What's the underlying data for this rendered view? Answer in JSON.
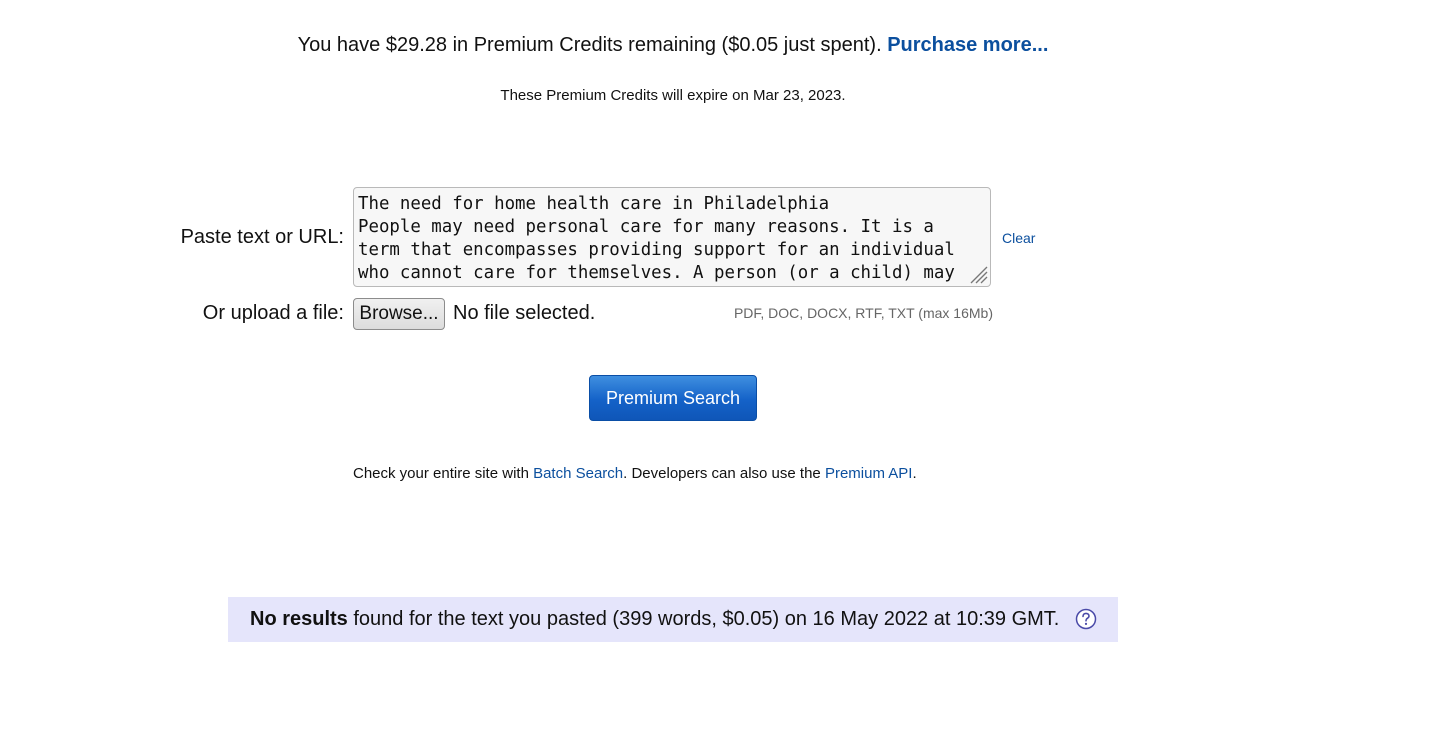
{
  "credits": {
    "text": "You have $29.28 in Premium Credits remaining ($0.05 just spent). ",
    "purchase_link": "Purchase more...",
    "expire_text": "These Premium Credits will expire on Mar 23, 2023."
  },
  "form": {
    "paste_label": "Paste text or URL:",
    "text_value": "The need for home health care in Philadelphia\nPeople may need personal care for many reasons. It is a term that encompasses providing support for an individual who cannot care for themselves. A person (or a child) may",
    "clear_link": "Clear",
    "upload_label": "Or upload a file:",
    "browse_label": "Browse...",
    "file_status": "No file selected.",
    "formats": "PDF, DOC, DOCX, RTF, TXT (max 16Mb)",
    "search_button": "Premium Search"
  },
  "batch": {
    "prefix": "Check your entire site with ",
    "batch_link": "Batch Search",
    "middle": ". Developers can also use the ",
    "api_link": "Premium API",
    "suffix": "."
  },
  "result": {
    "bold": "No results",
    "rest": " found for the text you pasted (399 words, $0.05) on 16 May 2022 at 10:39 GMT."
  },
  "colors": {
    "link": "#0b4f9e",
    "button": "#1462c8",
    "result_bg": "#e5e5fb"
  },
  "icons": {
    "help": "question-circle-icon",
    "resize": "resize-grip-icon"
  }
}
